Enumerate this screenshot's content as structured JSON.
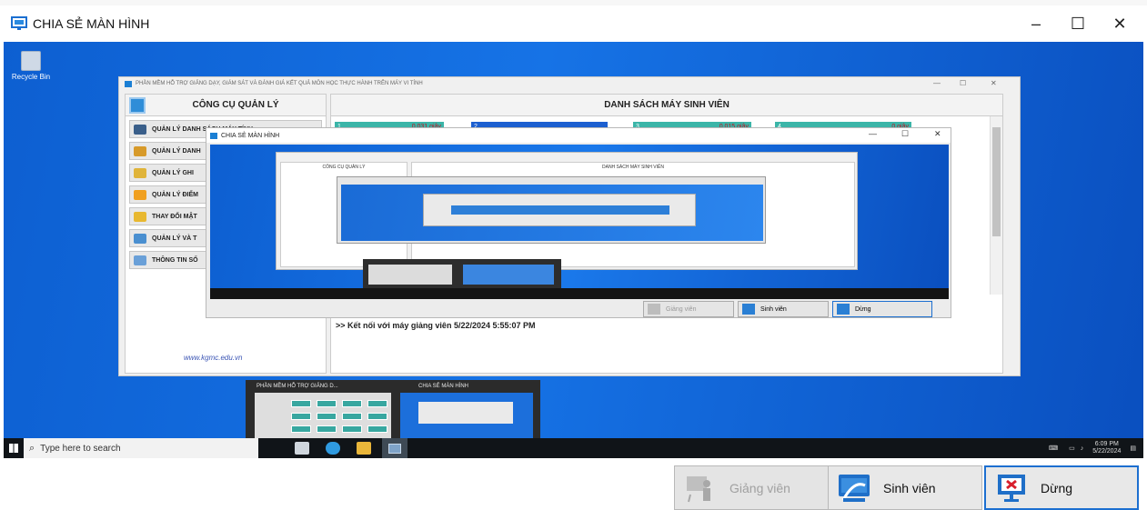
{
  "window": {
    "title": "CHIA SẺ MÀN HÌNH",
    "minimize": "–",
    "maximize": "☐",
    "close": "✕"
  },
  "desktop": {
    "recycle_bin_label": "Recycle Bin"
  },
  "app": {
    "title": "PHẦN MỀM HỖ TRỢ GIẢNG DẠY, GIÁM SÁT VÀ ĐÁNH GIÁ KẾT QUẢ MÔN HỌC THỰC HÀNH TRÊN MÁY VI TÍNH",
    "minimize": "—",
    "maximize": "☐",
    "close": "✕",
    "left_header": "CÔNG CỤ QUẢN LÝ",
    "right_header": "DANH SÁCH MÁY SINH VIÊN",
    "menu": [
      {
        "label": "QUẢN LÝ DANH SÁCH MÁY TÍNH",
        "color": "#3a5f8a"
      },
      {
        "label": "QUẢN LÝ DANH",
        "color": "#d79a2a"
      },
      {
        "label": "QUẢN LÝ GHI",
        "color": "#e0b43a"
      },
      {
        "label": "QUẢN LÝ ĐIỂM",
        "color": "#f0a020"
      },
      {
        "label": "THAY ĐỔI MẬT",
        "color": "#e8b830"
      },
      {
        "label": "QUẢN LÝ VÀ T",
        "color": "#4a8fd0"
      },
      {
        "label": "THÔNG TIN SỐ",
        "color": "#6aa0d8"
      }
    ],
    "tiles": [
      {
        "num": "1",
        "time": "0.031 giây"
      },
      {
        "num": "2",
        "time": ""
      },
      {
        "num": "3",
        "time": "0.015 giây"
      },
      {
        "num": "4",
        "time": "0 giây"
      }
    ],
    "log_line": ">> Kết nối với máy giảng viên 5/22/2024 5:55:07 PM",
    "website": "www.kgmc.edu.vn"
  },
  "inner_window": {
    "title": "CHIA SẺ MÀN HÌNH",
    "min": "—",
    "max": "☐",
    "close": "✕",
    "left_header": "CÔNG CỤ QUẢN LÝ",
    "right_header": "DANH SÁCH MÁY SINH VIÊN",
    "search": "Type here to search",
    "btn_teacher": "Giảng viên",
    "btn_student": "Sinh viên",
    "btn_stop": "Dừng"
  },
  "taskbar_preview": {
    "app_label": "PHẦN MỀM HỖ TRỢ GIẢNG D...",
    "share_label": "CHIA SẺ MÀN HÌNH"
  },
  "taskbar": {
    "search_placeholder": "Type here to search",
    "time": "6:09 PM",
    "date": "5/22/2024"
  },
  "buttons": {
    "teacher": "Giảng viên",
    "student": "Sinh viên",
    "stop": "Dừng"
  },
  "colors": {
    "desktop": "#1673e6",
    "tile": "#3bb5a8",
    "stop_border": "#1c6fd0"
  }
}
